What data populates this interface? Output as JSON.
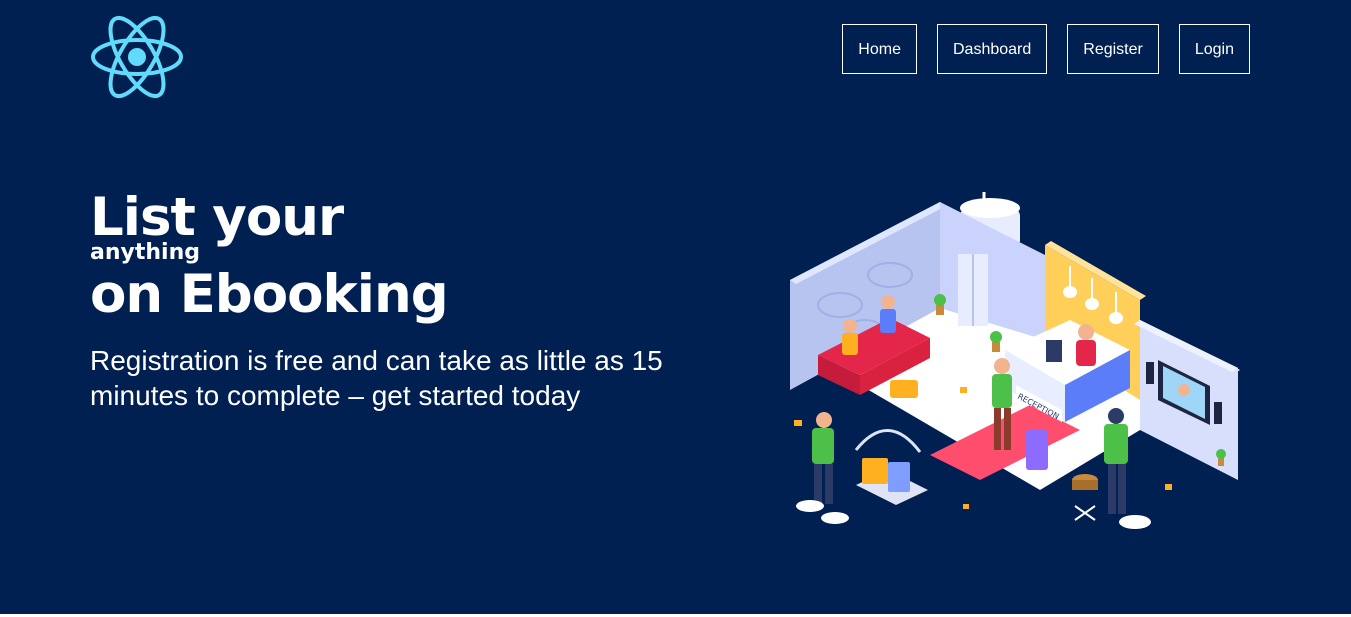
{
  "nav": {
    "items": [
      {
        "label": "Home"
      },
      {
        "label": "Dashboard"
      },
      {
        "label": "Register"
      },
      {
        "label": "Login"
      }
    ]
  },
  "hero": {
    "title_line1": "List your",
    "title_line2": "anything",
    "title_line3": "on Ebooking",
    "subtitle": "Registration is free and can take as little as 15 minutes to complete – get started today"
  },
  "illustration": {
    "sign_text": "RECEPTION"
  },
  "colors": {
    "background": "#002052",
    "logo": "#61dafb",
    "text": "#ffffff"
  }
}
